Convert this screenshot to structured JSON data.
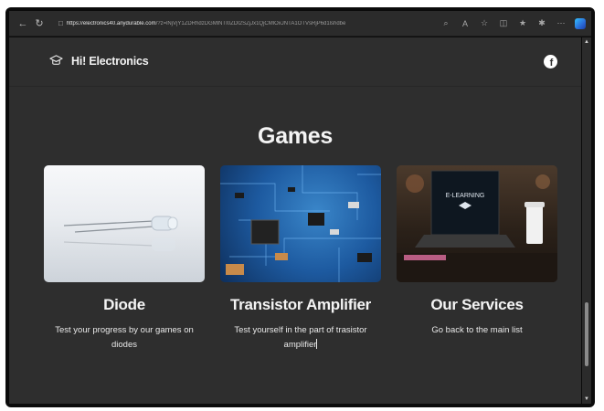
{
  "browser": {
    "url_domain": "https://electronics40.anydurable.com",
    "url_rest": "/?z=lNjVjY1ZDRhdzDGMlNTI0ZDI2SZjJx1QjCMlOxJNTA1OTVsRjP6d1lshdbe",
    "back_icon": "back-arrow-icon",
    "refresh_icon": "refresh-icon"
  },
  "header": {
    "brand_name": "Hi! Electronics",
    "social": "f"
  },
  "section": {
    "title": "Games"
  },
  "cards": [
    {
      "title": "Diode",
      "text": "Test your progress by our games on diodes"
    },
    {
      "title": "Transistor Amplifier",
      "text": "Test yourself in the part of trasistor amplifier"
    },
    {
      "title": "Our Services",
      "text": "Go back to the main list",
      "screen_text": "E-LEARNING"
    }
  ],
  "colors": {
    "page_bg": "#2e2e2e",
    "frame": "#0b0b0b",
    "text": "#f4f4f4"
  }
}
